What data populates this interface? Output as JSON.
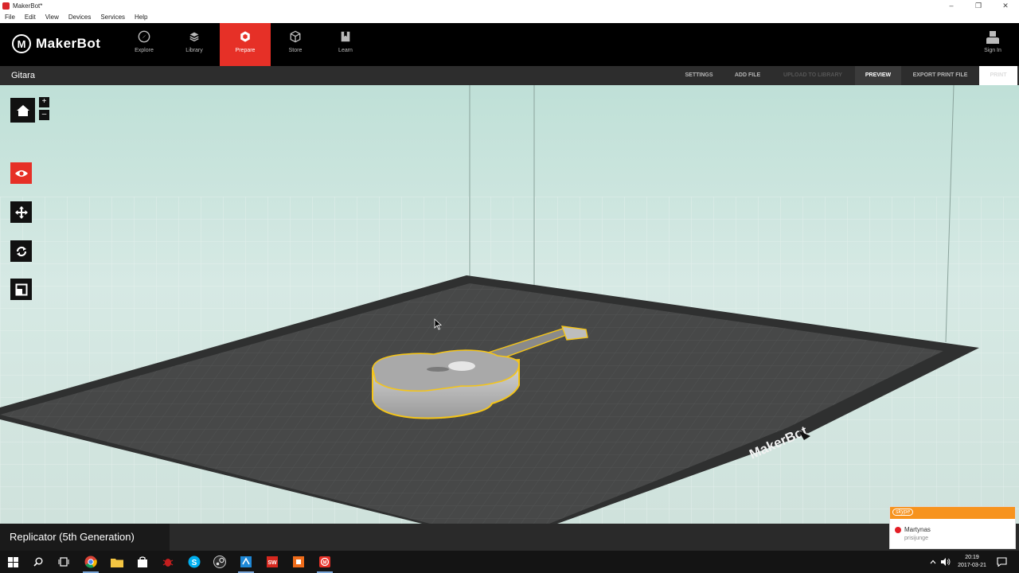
{
  "window": {
    "title": "MakerBot*"
  },
  "menu": [
    "File",
    "Edit",
    "View",
    "Devices",
    "Services",
    "Help"
  ],
  "nav": {
    "brand": "MakerBot",
    "tabs": [
      {
        "label": "Explore",
        "icon": "compass-icon"
      },
      {
        "label": "Library",
        "icon": "library-icon"
      },
      {
        "label": "Prepare",
        "icon": "prepare-icon",
        "active": true
      },
      {
        "label": "Store",
        "icon": "store-box-icon"
      },
      {
        "label": "Learn",
        "icon": "learn-book-icon"
      }
    ],
    "sign_in": "Sign In"
  },
  "project": {
    "name": "Gitara"
  },
  "toolbar": {
    "settings": "SETTINGS",
    "add_file": "ADD FILE",
    "upload": "UPLOAD TO LIBRARY",
    "preview": "PREVIEW",
    "export": "EXPORT PRINT FILE",
    "print": "PRINT"
  },
  "viewport": {
    "plate_brand": "MakerBot"
  },
  "printer": {
    "name": "Replicator (5th Generation)"
  },
  "notification": {
    "app": "skype",
    "user": "Martynas",
    "status": "prisijunge"
  },
  "taskbar": {
    "time": "20:19",
    "date": "2017-03-21"
  },
  "colors": {
    "accent": "#e63027",
    "selection": "#f5c518",
    "plate": "#474848"
  }
}
